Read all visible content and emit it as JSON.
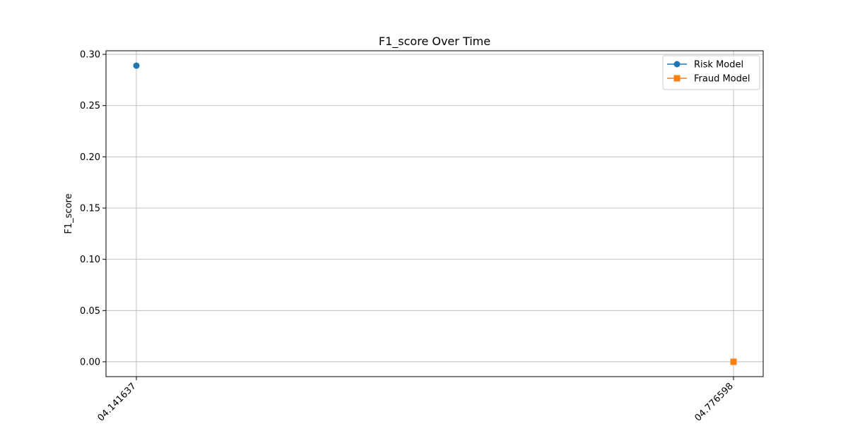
{
  "chart_data": {
    "type": "line",
    "title": "F1_score Over Time",
    "xlabel": "",
    "ylabel": "F1_score",
    "x_tick_labels": [
      "04.141637",
      "04.776598"
    ],
    "y_ticks": [
      0.0,
      0.05,
      0.1,
      0.15,
      0.2,
      0.25,
      0.3
    ],
    "y_tick_labels": [
      "0.00",
      "0.05",
      "0.10",
      "0.15",
      "0.20",
      "0.25",
      "0.30"
    ],
    "ylim": [
      -0.0145,
      0.3035
    ],
    "grid": true,
    "legend_position": "top-right",
    "series": [
      {
        "name": "Risk Model",
        "marker": "circle",
        "color": "#1f77b4",
        "points": [
          {
            "x_index": 0,
            "y": 0.289
          }
        ]
      },
      {
        "name": "Fraud Model",
        "marker": "square",
        "color": "#ff7f0e",
        "points": [
          {
            "x_index": 1,
            "y": 0.0
          }
        ]
      }
    ]
  }
}
